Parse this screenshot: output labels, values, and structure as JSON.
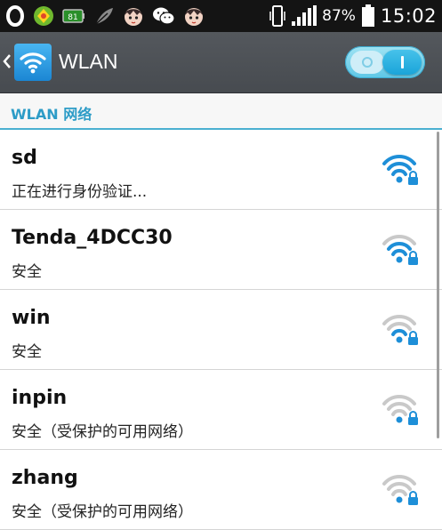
{
  "status_bar": {
    "battery_percent": "87%",
    "time": "15:02",
    "left_icons": [
      "opera-icon",
      "app-store-icon",
      "battery-app-icon",
      "feather-icon",
      "avatar-icon",
      "wechat-icon",
      "avatar-icon"
    ],
    "right_icons": [
      "vibrate-icon",
      "signal-icon",
      "battery-icon"
    ]
  },
  "action_bar": {
    "title": "WLAN",
    "toggle_on": true
  },
  "section": {
    "title": "WLAN 网络"
  },
  "networks": [
    {
      "name": "sd",
      "status": "正在进行身份验证...",
      "signal": "strong"
    },
    {
      "name": "Tenda_4DCC30",
      "status": "安全",
      "signal": "weak"
    },
    {
      "name": "win",
      "status": "安全",
      "signal": "weak"
    },
    {
      "name": "inpin",
      "status": "安全（受保护的可用网络）",
      "signal": "weak"
    },
    {
      "name": "zhang",
      "status": "安全（受保护的可用网络）",
      "signal": "weak"
    }
  ],
  "colors": {
    "accent": "#2d9cc7",
    "signal_active": "#1e8fd8",
    "signal_inactive": "#c9c9c9"
  }
}
